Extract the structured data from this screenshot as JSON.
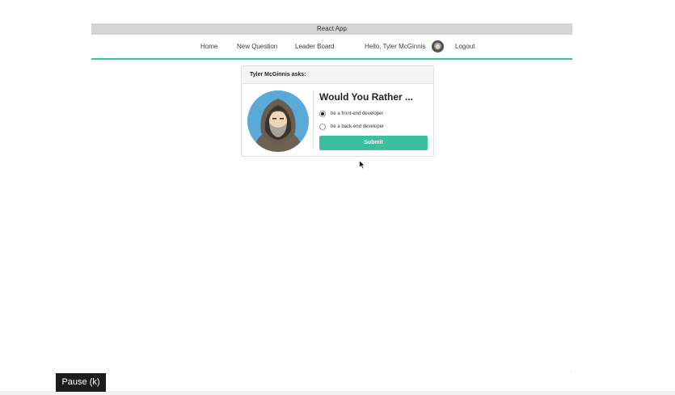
{
  "window": {
    "title": "React App"
  },
  "nav": {
    "home": "Home",
    "new_question": "New Question",
    "leader_board": "Leader Board",
    "greeting": "Hello, Tyler McGinnis",
    "logout": "Logout"
  },
  "question_card": {
    "header": "Tyler McGinnis asks:",
    "title": "Would You Rather ...",
    "options": [
      {
        "label": "be a front-end developer",
        "selected": true
      },
      {
        "label": "be a back-end developer",
        "selected": false
      }
    ],
    "submit_label": "Submit"
  },
  "player": {
    "pause_label": "Pause (k)"
  },
  "colors": {
    "accent": "#3bbfa0",
    "titlebar": "#d4d4d4",
    "avatar_bg": "#5aaad8"
  },
  "icons": {
    "author_avatar": "hooded-man-avatar",
    "nav_avatar": "user-avatar-icon",
    "cursor": "mouse-cursor"
  }
}
